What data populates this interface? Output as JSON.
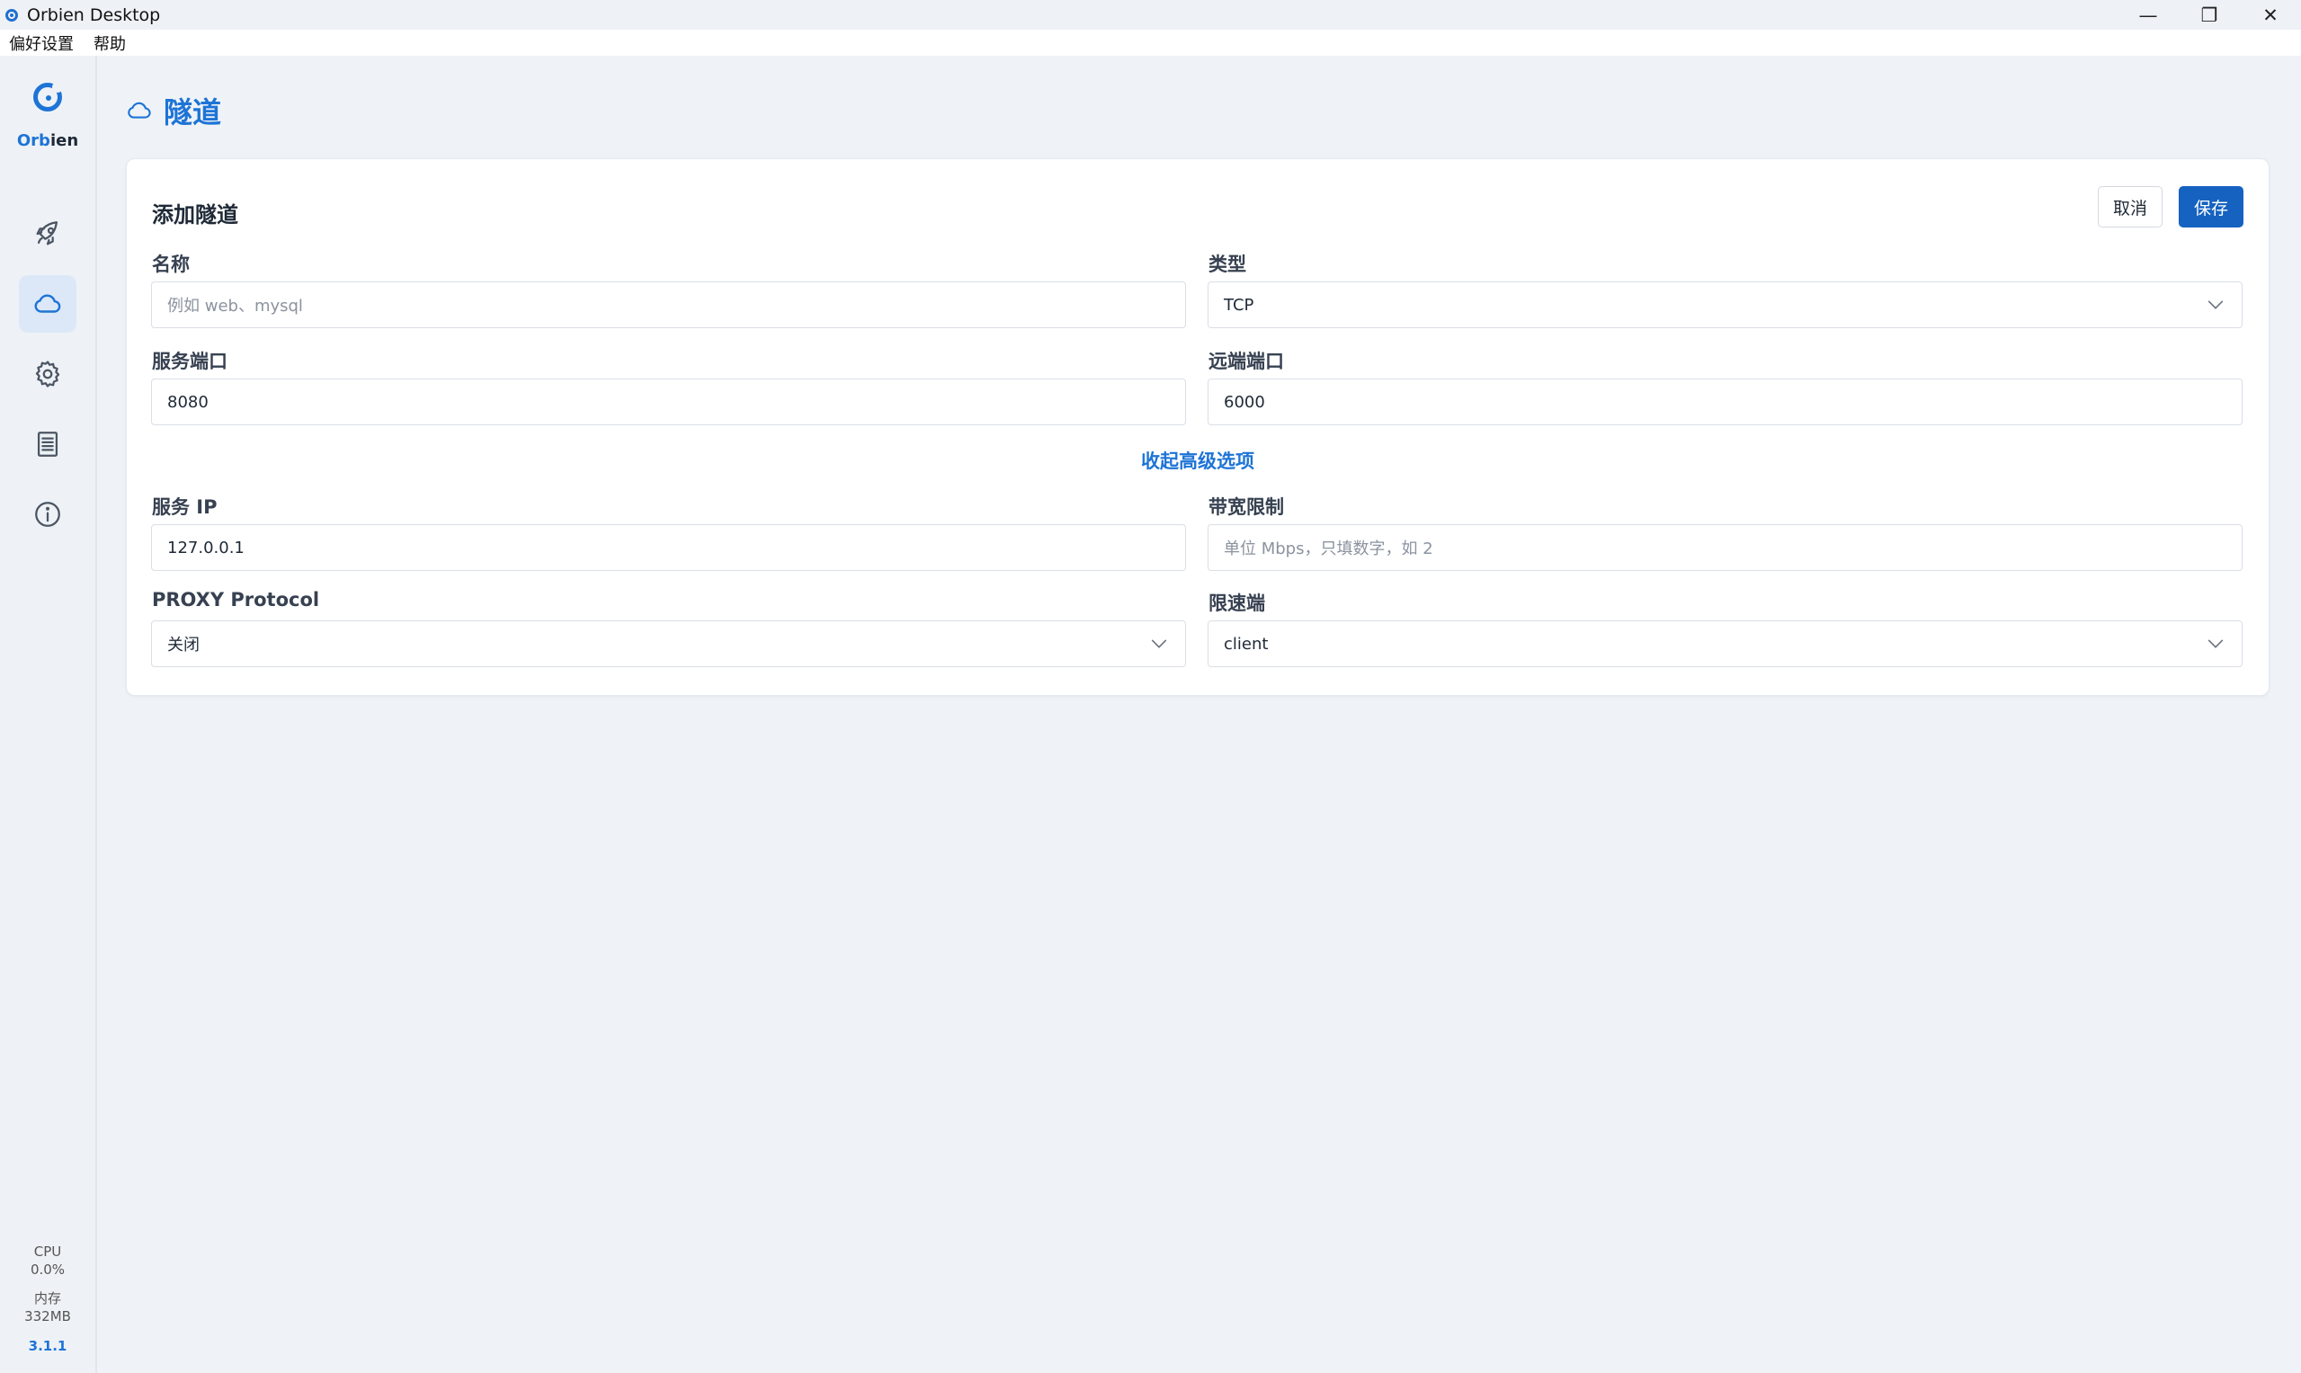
{
  "window": {
    "title": "Orbien Desktop",
    "minimize": "—",
    "maximize": "❐",
    "close": "✕"
  },
  "menu": {
    "items": [
      "偏好设置",
      "帮助"
    ]
  },
  "sidebar": {
    "brand_part1": "Orb",
    "brand_part2": "ien",
    "nav": [
      {
        "name": "launch",
        "icon": "rocket-icon"
      },
      {
        "name": "tunnels",
        "icon": "cloud-icon",
        "active": true
      },
      {
        "name": "settings",
        "icon": "gear-icon"
      },
      {
        "name": "logs",
        "icon": "document-icon"
      },
      {
        "name": "about",
        "icon": "info-icon"
      }
    ],
    "cpu_label": "CPU",
    "cpu_value": "0.0%",
    "mem_label": "内存",
    "mem_value": "332MB",
    "version": "3.1.1"
  },
  "page": {
    "title": "隧道",
    "title_icon": "cloud-icon"
  },
  "form": {
    "title": "添加隧道",
    "cancel_label": "取消",
    "save_label": "保存",
    "name": {
      "label": "名称",
      "placeholder": "例如 web、mysql",
      "value": ""
    },
    "type": {
      "label": "类型",
      "value": "TCP"
    },
    "local_port": {
      "label": "服务端口",
      "value": "8080"
    },
    "remote_port": {
      "label": "远端端口",
      "value": "6000"
    },
    "toggle_advanced": "收起高级选项",
    "local_ip": {
      "label": "服务 IP",
      "value": "127.0.0.1"
    },
    "bandwidth": {
      "label": "带宽限制",
      "placeholder": "单位 Mbps，只填数字，如 2",
      "value": ""
    },
    "proxy_protocol": {
      "label": "PROXY Protocol",
      "value": "关闭"
    },
    "limit_side": {
      "label": "限速端",
      "value": "client"
    }
  },
  "colors": {
    "accent": "#1e74d6",
    "save_button": "#1562c0",
    "background": "#eff3f8"
  }
}
